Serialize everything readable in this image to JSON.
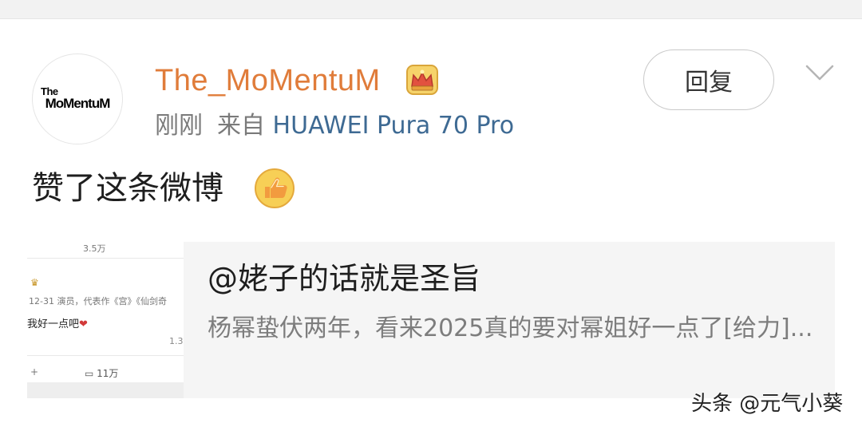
{
  "post": {
    "username": "The_MoMentuM",
    "avatar_logo_top": "The",
    "avatar_logo_main": "MoMentuM",
    "time": "刚刚",
    "source_prefix": "来自 ",
    "source_name": "HUAWEI Pura 70 Pro",
    "reply_label": "回复",
    "action_text": "赞了这条微博"
  },
  "card": {
    "title": "@姥子的话就是圣旨",
    "description": "杨幂蛰伏两年，看来2025真的要对幂姐好一点了[给力]...",
    "thumbnail": {
      "top_count": "3.5万",
      "date_line": "12-31  演员，代表作《宫》《仙剑奇",
      "text_line": "我好一点吧",
      "side_count": "1.3",
      "plus": "+",
      "bottom_count": "11万"
    }
  },
  "watermark": "头条 @元气小葵",
  "colors": {
    "username": "#e07c3a",
    "source_link": "#3e6a93",
    "card_background": "#f5f5f5"
  },
  "icons": [
    "crown-icon",
    "thumbs-up-icon",
    "chevron-down-icon",
    "comment-icon",
    "heart-icon"
  ]
}
